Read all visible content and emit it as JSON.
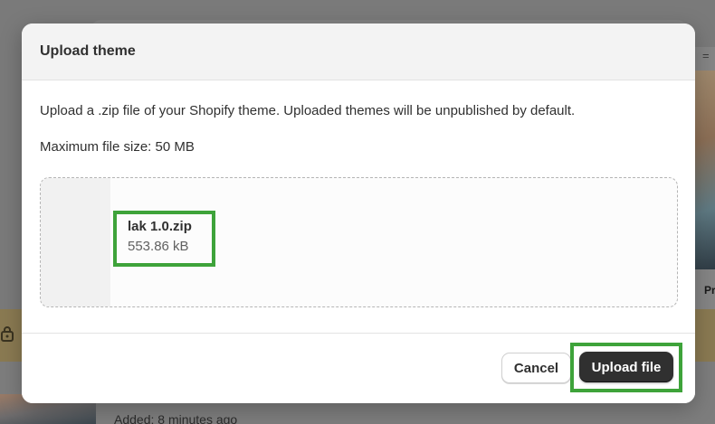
{
  "background": {
    "right_menu_icon": "equals-icon",
    "right_label": "Pr",
    "added_text": "Added: 8 minutes ago"
  },
  "modal": {
    "title": "Upload theme",
    "description": "Upload a .zip file of your Shopify theme. Uploaded themes will be unpublished by default.",
    "max_file_size": "Maximum file size: 50 MB",
    "file": {
      "name": "lak 1.0.zip",
      "size": "553.86 kB"
    },
    "footer": {
      "cancel_label": "Cancel",
      "upload_label": "Upload file"
    }
  },
  "colors": {
    "highlight": "#3ea33a",
    "primary_button": "#303030"
  }
}
